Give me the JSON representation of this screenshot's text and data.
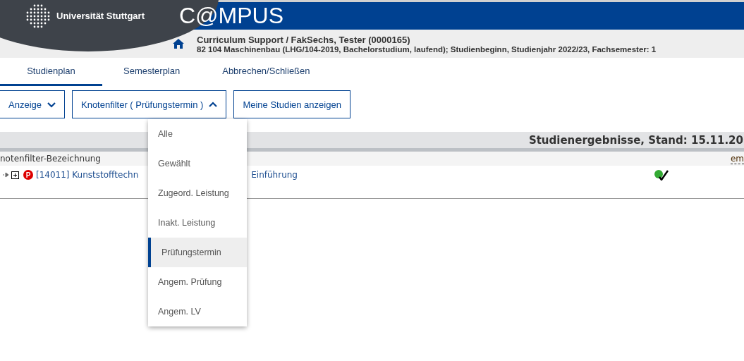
{
  "header": {
    "university": "Universität Stuttgart",
    "app_title": "C@MPUS"
  },
  "context": {
    "line_1": "Curriculum Support  / FakSechs, Tester (0000165)",
    "line_2": "82 104 Maschinenbau (LHG/104-2019, Bachelorstudium, laufend); Studienbeginn, Studienjahr 2022/23, Fachsemester: 1"
  },
  "tabs": [
    {
      "label": "Studienplan",
      "selected": true
    },
    {
      "label": "Semesterplan",
      "selected": false
    },
    {
      "label": "Abbrechen/Schließen",
      "selected": false
    }
  ],
  "toolbar": [
    {
      "label": "Anzeige",
      "kind": "dropdown",
      "expanded": false
    },
    {
      "label": "Knotenfilter ( Prüfungstermin )",
      "kind": "dropdown",
      "expanded": true
    },
    {
      "label": "Meine Studien anzeigen",
      "kind": "button"
    }
  ],
  "results": {
    "title": "Studienergebnisse, Stand: 15.11.20",
    "column_1": "notenfilter-Bezeichnung",
    "column_2": "em",
    "rows": [
      {
        "text_before": "[14011] Kunststofftechn",
        "text_after": "Einführung",
        "badge": "P",
        "passed": true
      }
    ]
  },
  "filter_menu": [
    {
      "label": "Alle",
      "selected": false
    },
    {
      "label": "Gewählt",
      "selected": false
    },
    {
      "label": "Zugeord. Leistung",
      "selected": false
    },
    {
      "label": "Inakt. Leistung",
      "selected": false
    },
    {
      "label": "Prüfungstermin",
      "selected": true
    },
    {
      "label": "Angem. Prüfung",
      "selected": false
    },
    {
      "label": "Angem. LV",
      "selected": false
    }
  ]
}
